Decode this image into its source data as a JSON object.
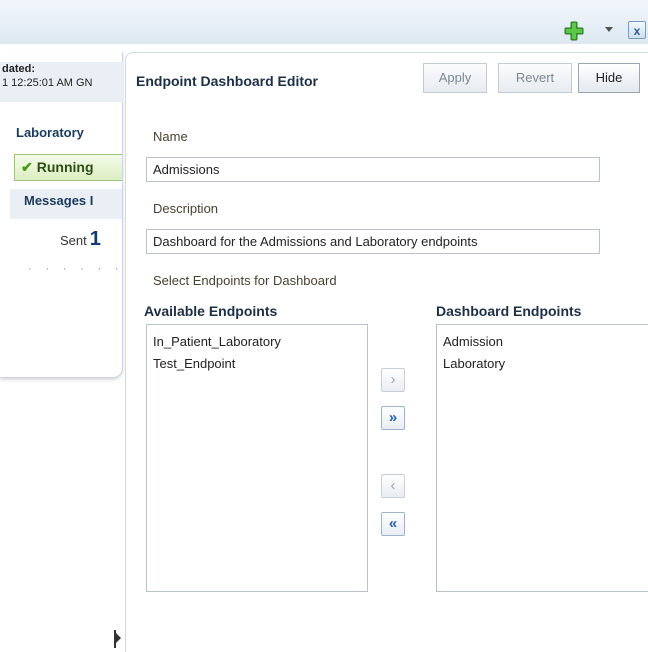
{
  "toolbar": {
    "add_icon": "green-plus-icon",
    "menu_icon": "chevron-down-icon",
    "close_label": "x"
  },
  "background_panel": {
    "updated_label": "dated:",
    "updated_time": "1 12:25:01 AM GN",
    "endpoint_name": "Laboratory",
    "status": "Running",
    "messages_label": "Messages I",
    "sent_label": "Sent",
    "sent_value": "1",
    "dots": "· · · · · ·"
  },
  "editor": {
    "title": "Endpoint Dashboard Editor",
    "apply_label": "Apply",
    "revert_label": "Revert",
    "hide_label": "Hide",
    "name_label": "Name",
    "name_value": "Admissions",
    "description_label": "Description",
    "description_value": "Dashboard for the Admissions and Laboratory endpoints",
    "select_label": "Select Endpoints for Dashboard",
    "available_header": "Available Endpoints",
    "dashboard_header": "Dashboard Endpoints",
    "available_items": [
      "In_Patient_Laboratory",
      "Test_Endpoint"
    ],
    "dashboard_items": [
      "Admission",
      "Laboratory"
    ],
    "move_label": "›",
    "move_all_label": "»",
    "remove_label": "‹",
    "remove_all_label": "«"
  },
  "colors": {
    "accent": "#1d5fb8",
    "running_green": "#4a9a1a"
  }
}
